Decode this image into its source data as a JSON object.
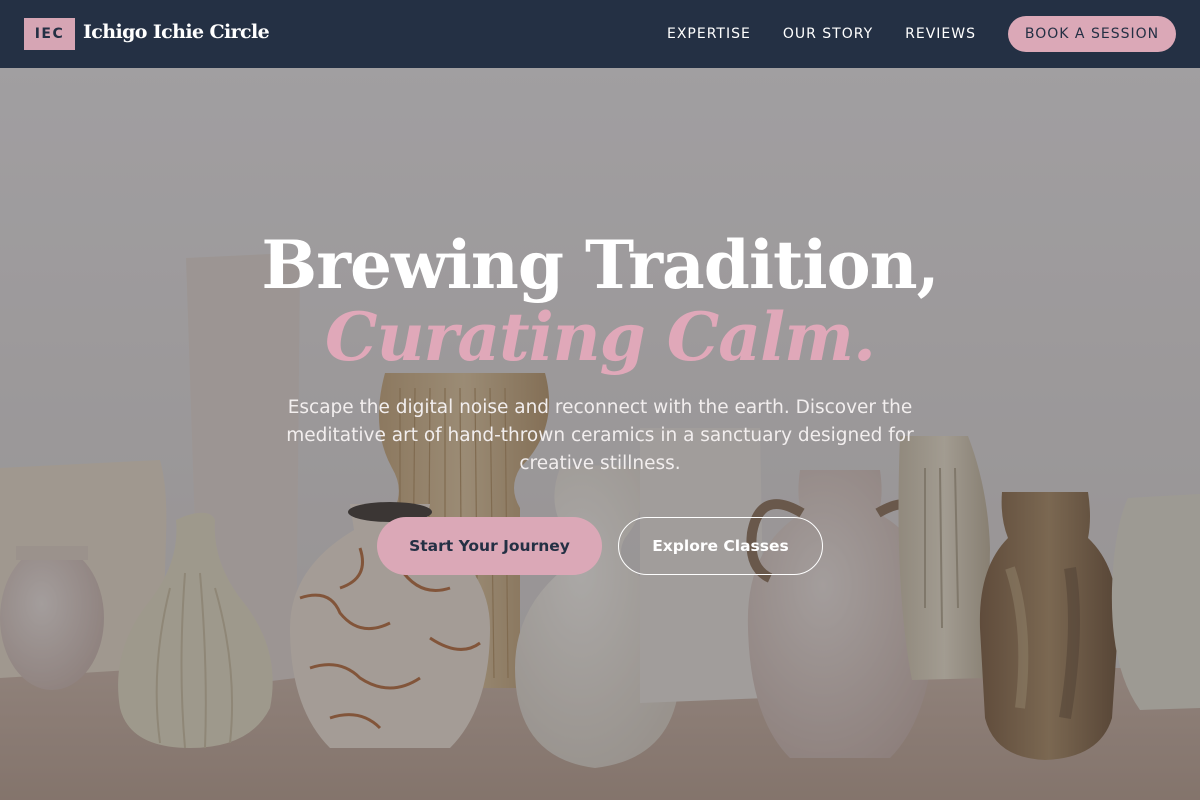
{
  "nav": {
    "logo_badge": "IEC",
    "brand_name": "Ichigo Ichie Circle",
    "links": [
      "EXPERTISE",
      "OUR STORY",
      "REVIEWS"
    ],
    "cta_label": "BOOK A SESSION"
  },
  "hero": {
    "headline_line1": "Brewing Tradition,",
    "headline_line2": "Curating Calm.",
    "subtext": "Escape the digital noise and reconnect with the earth. Discover the meditative art of hand-thrown ceramics in a sanctuary designed for creative stillness.",
    "primary_cta": "Start Your Journey",
    "secondary_cta": "Explore Classes",
    "background_image": "ceramic-vases-photo"
  },
  "colors": {
    "nav_bg": "#243044",
    "accent_pink": "#dba8b7",
    "headline_pink": "#e0a8b9",
    "white": "#ffffff"
  }
}
